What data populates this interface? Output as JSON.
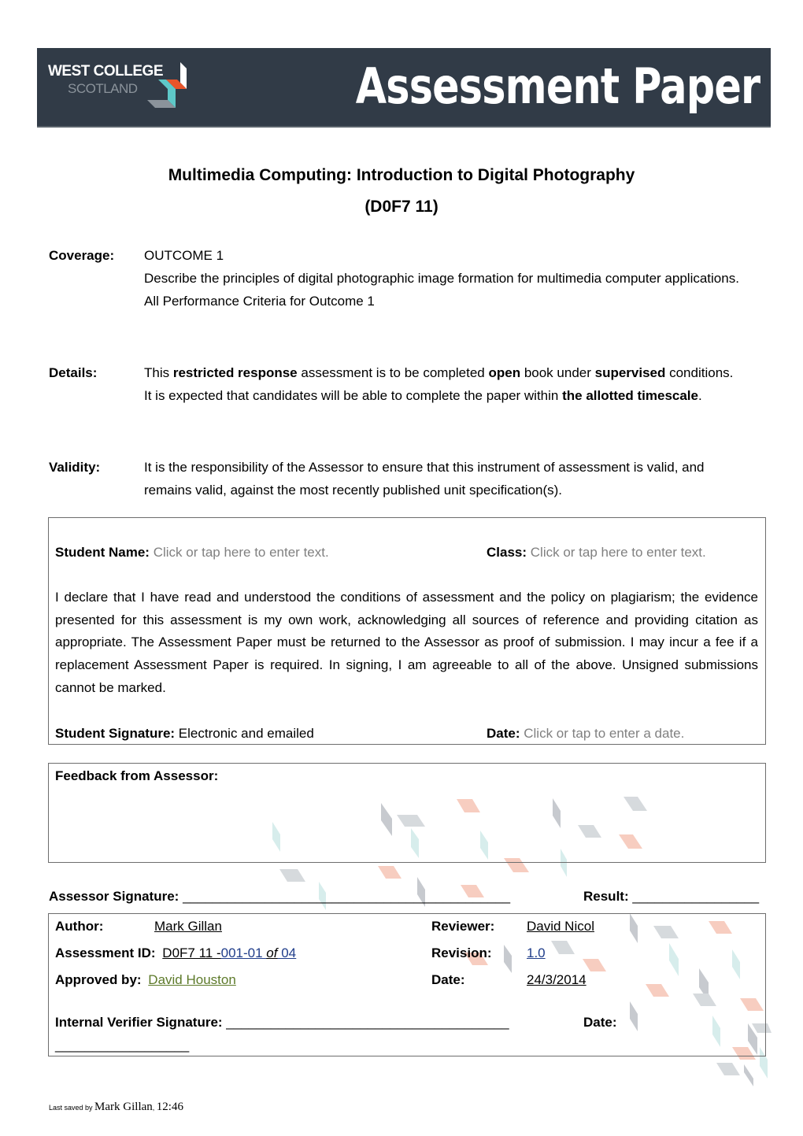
{
  "banner": {
    "logo_line1": "WEST COLLEGE",
    "logo_line2": "SCOTLAND",
    "title": "Assessment Paper",
    "colors": {
      "background": "#313b47",
      "logo_orange": "#e8542a",
      "logo_teal": "#5ec8c8",
      "logo_grey": "#8b939b"
    }
  },
  "document": {
    "title": "Multimedia Computing: Introduction to Digital Photography",
    "code": "(D0F7 11)"
  },
  "coverage": {
    "label": "Coverage:",
    "lines": [
      "OUTCOME 1",
      "Describe the principles of digital photographic image formation for multimedia computer applications.",
      "All Performance Criteria for Outcome 1"
    ]
  },
  "details": {
    "label": "Details:",
    "parts": [
      "This ",
      "restricted response",
      " assessment is to be completed ",
      "open",
      " book under ",
      "supervised",
      " conditions.  It is expected that candidates will be able to complete the paper within ",
      "the allotted timescale",
      "."
    ]
  },
  "validity": {
    "label": "Validity:",
    "text": "It is the responsibility of the Assessor to ensure that this instrument of assessment is valid, and remains valid, against the most recently published unit specification(s)."
  },
  "student_box": {
    "name_label": "Student Name:",
    "name_placeholder": "Click or tap here to enter text.",
    "class_label": "Class:",
    "class_placeholder": "Click or tap here to enter text.",
    "declaration": "I declare that I have read and understood the conditions of assessment and the policy on plagiarism; the evidence presented for this assessment is my own work, acknowledging all sources of reference and providing citation as appropriate. The Assessment Paper must be returned to the Assessor as proof of submission. I may incur a fee if a replacement Assessment Paper is required. In signing, I am agreeable to all of the above. Unsigned submissions cannot be marked.",
    "signature_label": "Student Signature:",
    "signature_value": "Electronic and emailed",
    "date_label": "Date:",
    "date_placeholder": "Click or tap to enter a date."
  },
  "feedback": {
    "label": "Feedback from Assessor:",
    "value": ""
  },
  "assessor_line": {
    "signature_label": "Assessor Signature:",
    "signature_blank": "____________________________________________",
    "result_label": "Result:",
    "result_blank": "_________________"
  },
  "meta_box": {
    "author_label": "Author:",
    "author_value": "Mark Gillan",
    "reviewer_label": "Reviewer:",
    "reviewer_value": "David Nicol",
    "assessment_id_label": "Assessment ID:",
    "assessment_id_prefix": "D0F7 11 -",
    "assessment_id_num": "001-01 ",
    "assessment_id_of": "of",
    "assessment_id_total": " 04",
    "revision_label": "Revision:",
    "revision_value": "1.0",
    "approved_label": "Approved by:",
    "approved_value": "David Houston",
    "date_label": "Date:",
    "date_value": "24/3/2014",
    "verifier_label": "Internal Verifier Signature:",
    "verifier_blank": "______________________________________",
    "verifier_date_label": "Date:",
    "verifier_date_blank": "__________________"
  },
  "footer": {
    "prefix": "Last saved by ",
    "author": "Mark Gillan",
    "sep": ", ",
    "time": "12:46"
  }
}
